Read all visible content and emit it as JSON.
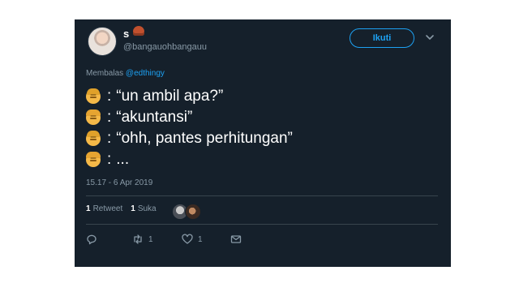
{
  "tweet": {
    "author": {
      "display_name": "s",
      "handle": "@bangauohbangauu"
    },
    "follow_label": "Ikuti",
    "reply_prefix": "Membalas",
    "reply_to": "@edthingy",
    "lines": [
      {
        "speaker": "boy",
        "text": "“un ambil apa?”"
      },
      {
        "speaker": "girl",
        "text": "“akuntansi”"
      },
      {
        "speaker": "boy",
        "text": "“ohh, pantes perhitungan”"
      },
      {
        "speaker": "girl",
        "text": "..."
      }
    ],
    "timestamp": "15.17 - 6 Apr 2019",
    "stats": {
      "retweet_count": "1",
      "retweet_label": "Retweet",
      "like_count": "1",
      "like_label": "Suka"
    },
    "actions": {
      "reply_count": "",
      "retweet_count": "1",
      "like_count": "1"
    }
  },
  "colors": {
    "background": "#15202b",
    "accent": "#1da1f2",
    "muted": "#8899a6"
  }
}
